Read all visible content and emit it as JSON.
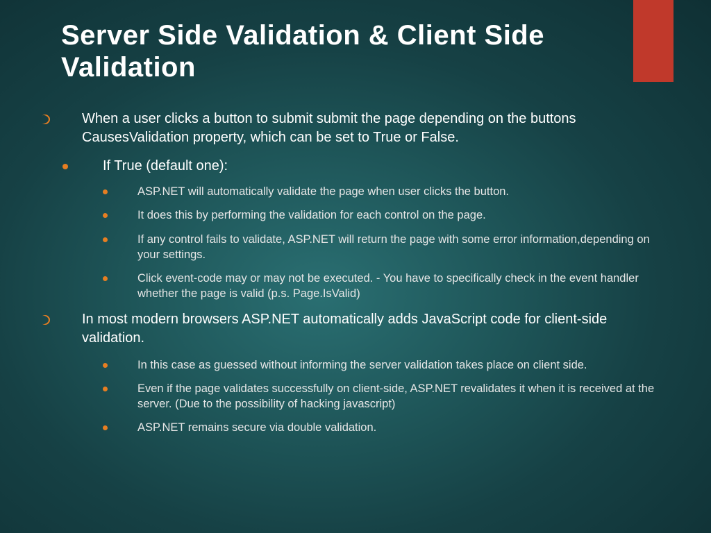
{
  "title": "Server Side Validation & Client Side Validation",
  "bullets": {
    "b1": "When a user clicks a button to submit submit the page depending on the buttons CausesValidation property, which can be set to True or False.",
    "b2": "If True (default one):",
    "b2_1": "ASP.NET will automatically validate the page when user clicks the button.",
    "b2_2": "It does this by performing the validation for each control on the page.",
    "b2_3": "If any control fails to validate, ASP.NET will return the page with some error information,depending on your settings.",
    "b2_4": "Click event-code may or may not be executed. - You have to specifically check in the event handler whether the page is valid (p.s. Page.IsValid)",
    "b3": "In most modern browsers ASP.NET automatically adds JavaScript code for client-side validation.",
    "b3_1": "In this case as guessed without informing the server validation takes place on client side.",
    "b3_2": "Even if the page validates successfully on client-side, ASP.NET revalidates it when it is received at the server. (Due to the possibility of hacking javascript)",
    "b3_3": "ASP.NET remains secure via double validation."
  }
}
